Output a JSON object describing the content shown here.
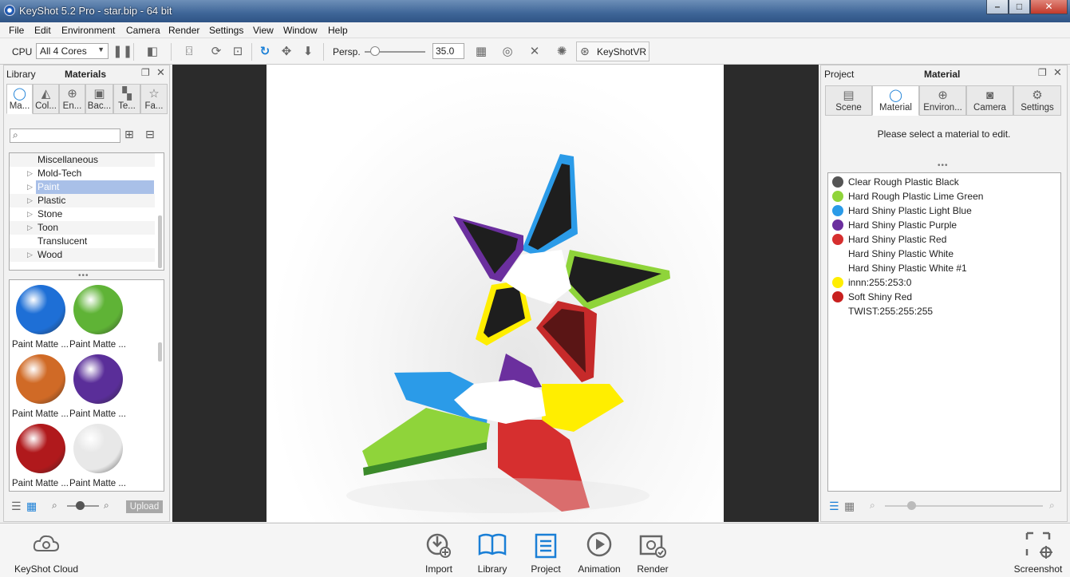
{
  "window": {
    "title": "KeyShot 5.2 Pro  -  star.bip  -  64 bit",
    "min": "–",
    "max": "□",
    "close": "✕"
  },
  "menu": [
    "File",
    "Edit",
    "Environment",
    "Camera",
    "Render",
    "Settings",
    "View",
    "Window",
    "Help"
  ],
  "toolbar": {
    "cpu_label": "CPU",
    "cores_value": "All 4 Cores",
    "persp_label": "Persp.",
    "persp_value": "35.0",
    "keyshotvr_label": "KeyShotVR"
  },
  "library": {
    "title_left": "Library",
    "title_center": "Materials",
    "tabs": [
      "Ma...",
      "Col...",
      "En...",
      "Bac...",
      "Te...",
      "Fa..."
    ],
    "search_placeholder": "",
    "tree": [
      {
        "label": "Miscellaneous",
        "arrow": false
      },
      {
        "label": "Mold-Tech",
        "arrow": true
      },
      {
        "label": "Paint",
        "arrow": true,
        "selected": true
      },
      {
        "label": "Plastic",
        "arrow": true
      },
      {
        "label": "Stone",
        "arrow": true
      },
      {
        "label": "Toon",
        "arrow": true
      },
      {
        "label": "Translucent",
        "arrow": false
      },
      {
        "label": "Wood",
        "arrow": true
      }
    ],
    "thumbnails": [
      {
        "label": "Paint Matte ...",
        "color": "#1e6fd6"
      },
      {
        "label": "Paint Matte ...",
        "color": "#5fb336"
      },
      {
        "label": "Paint Matte ...",
        "color": "#d06a26"
      },
      {
        "label": "Paint Matte ...",
        "color": "#5a2e99"
      },
      {
        "label": "Paint Matte ...",
        "color": "#b0191c"
      },
      {
        "label": "Paint Matte ...",
        "color": "#e8e8e8"
      }
    ],
    "upload_label": "Upload"
  },
  "project": {
    "title_left": "Project",
    "title_center": "Material",
    "tabs": [
      "Scene",
      "Material",
      "Environ...",
      "Camera",
      "Settings"
    ],
    "message": "Please select a material to edit.",
    "materials": [
      {
        "name": "Clear Rough Plastic Black",
        "color": "#555555"
      },
      {
        "name": "Hard Rough Plastic Lime Green",
        "color": "#8fd43a"
      },
      {
        "name": "Hard Shiny Plastic Light Blue",
        "color": "#2b9be8"
      },
      {
        "name": "Hard Shiny Plastic Purple",
        "color": "#6b2f9e"
      },
      {
        "name": "Hard Shiny Plastic Red",
        "color": "#d62f2f"
      },
      {
        "name": "Hard Shiny Plastic White",
        "color": ""
      },
      {
        "name": "Hard Shiny Plastic White #1",
        "color": ""
      },
      {
        "name": "innn:255:253:0",
        "color": "#ffee00"
      },
      {
        "name": "Soft Shiny Red",
        "color": "#c8201f"
      },
      {
        "name": "TWIST:255:255:255",
        "color": ""
      }
    ]
  },
  "bottom": {
    "cloud": "KeyShot Cloud",
    "import": "Import",
    "library": "Library",
    "project": "Project",
    "animation": "Animation",
    "render": "Render",
    "screenshot": "Screenshot"
  }
}
